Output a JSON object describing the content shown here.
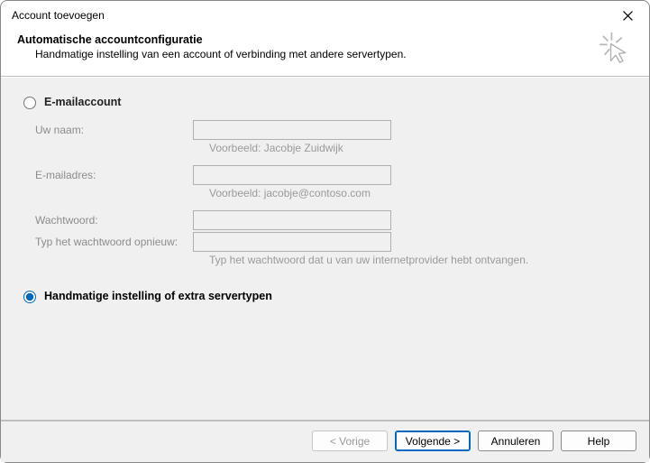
{
  "window": {
    "title": "Account toevoegen"
  },
  "header": {
    "title": "Automatische accountconfiguratie",
    "subtitle": "Handmatige instelling van een account of verbinding met andere servertypen."
  },
  "radios": {
    "email": {
      "label": "E-mailaccount",
      "checked": false
    },
    "manual": {
      "label": "Handmatige instelling of extra servertypen",
      "checked": true
    }
  },
  "form": {
    "name": {
      "label": "Uw naam:",
      "value": "",
      "hint": "Voorbeeld: Jacobje Zuidwijk"
    },
    "email": {
      "label": "E-mailadres:",
      "value": "",
      "hint": "Voorbeeld: jacobje@contoso.com"
    },
    "password": {
      "label": "Wachtwoord:",
      "value": ""
    },
    "password2": {
      "label": "Typ het wachtwoord opnieuw:",
      "value": "",
      "hint": "Typ het wachtwoord dat u van uw internetprovider hebt ontvangen."
    }
  },
  "buttons": {
    "back": "< Vorige",
    "next": "Volgende >",
    "cancel": "Annuleren",
    "help": "Help"
  }
}
